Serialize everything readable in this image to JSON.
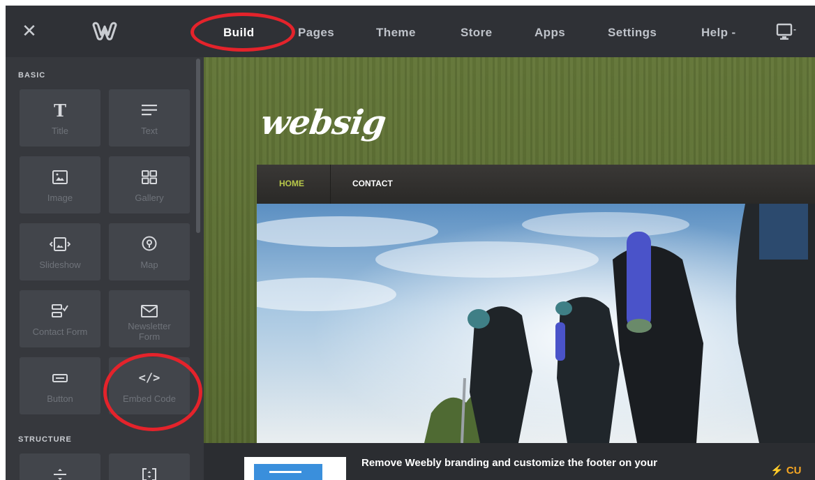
{
  "topbar": {
    "close_icon": "close-icon",
    "logo_icon": "weebly-logo-icon",
    "nav": [
      "Build",
      "Pages",
      "Theme",
      "Store",
      "Apps",
      "Settings",
      "Help -"
    ],
    "active_nav": "Build",
    "device_icon": "desktop-icon",
    "device_suffix": "-"
  },
  "sidebar": {
    "basic_label": "BASIC",
    "structure_label": "STRUCTURE",
    "tiles": [
      {
        "label": "Title",
        "icon": "title-icon"
      },
      {
        "label": "Text",
        "icon": "text-icon"
      },
      {
        "label": "Image",
        "icon": "image-icon"
      },
      {
        "label": "Gallery",
        "icon": "gallery-icon"
      },
      {
        "label": "Slideshow",
        "icon": "slideshow-icon"
      },
      {
        "label": "Map",
        "icon": "map-pin-icon"
      },
      {
        "label": "Contact Form",
        "icon": "contact-form-icon"
      },
      {
        "label": "Newsletter Form",
        "icon": "envelope-icon"
      },
      {
        "label": "Button",
        "icon": "button-icon"
      },
      {
        "label": "Embed Code",
        "icon": "code-icon"
      }
    ]
  },
  "site": {
    "logo_text": "websig",
    "nav": {
      "home": "HOME",
      "contact": "CONTACT"
    },
    "hero_alt": "hikers-photo"
  },
  "promo": {
    "text": "Remove Weebly branding and customize the footer on your",
    "cta": "⚡ CU"
  },
  "colors": {
    "highlight": "#e4232b",
    "topbar": "#2f3136",
    "sidebar": "#36383d",
    "tile": "#42454b",
    "home_link": "#b8c84a",
    "cta": "#f5a623"
  }
}
